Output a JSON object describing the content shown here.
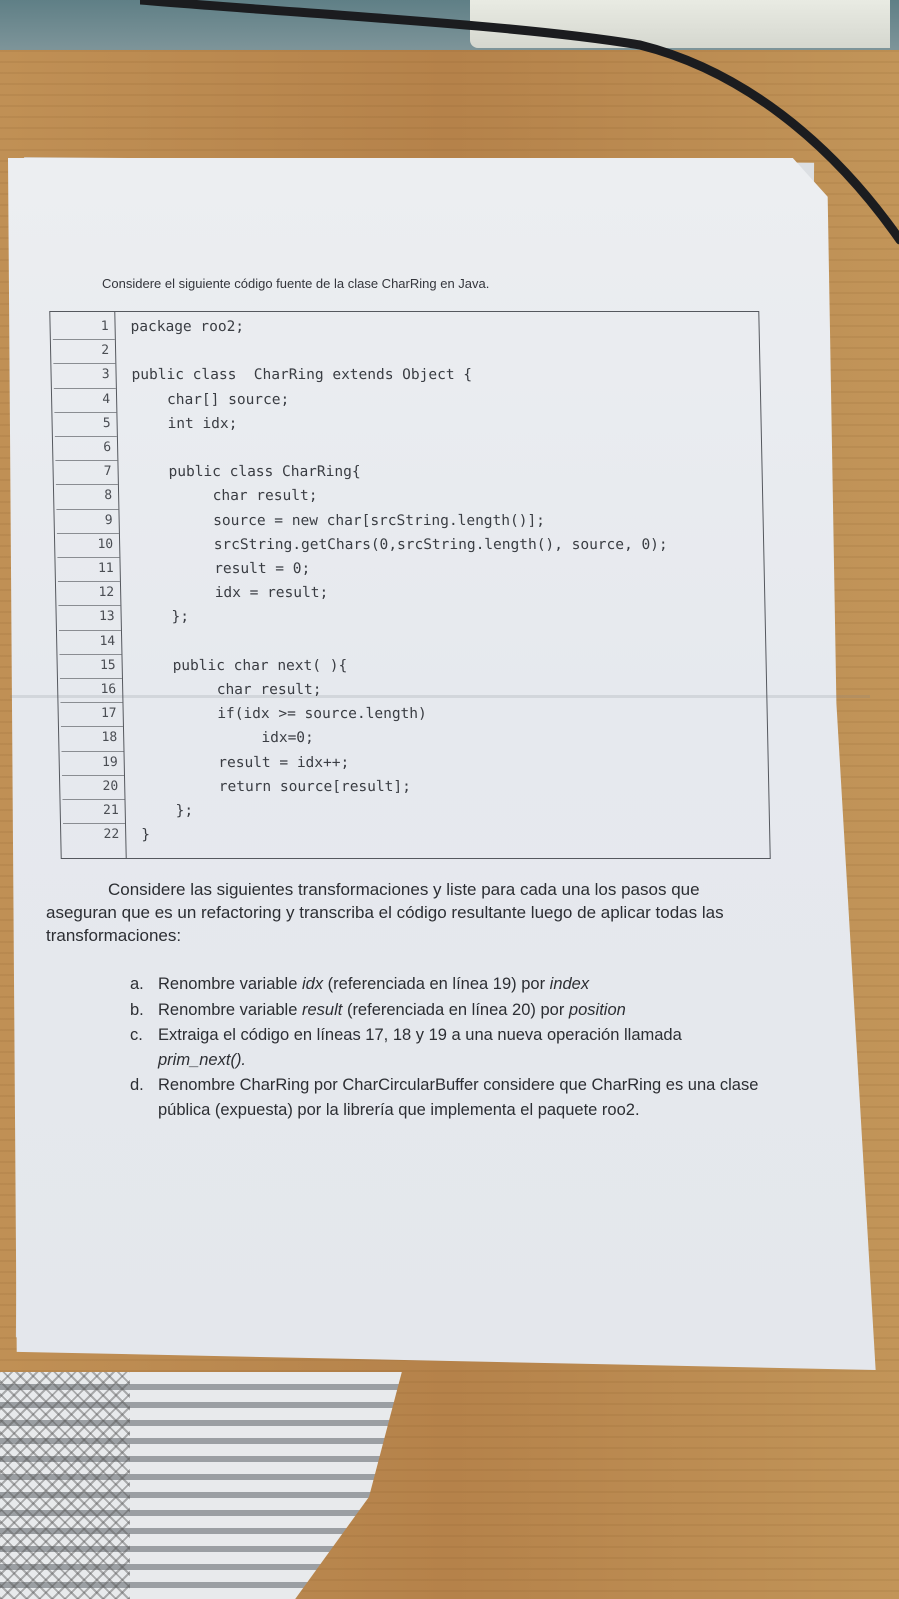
{
  "intro": "Considere el siguiente código fuente de la clase CharRing en Java.",
  "code_lines": [
    {
      "n": "1",
      "text": "package roo2;"
    },
    {
      "n": "2",
      "text": ""
    },
    {
      "n": "3",
      "text": "public class  CharRing extends Object {"
    },
    {
      "n": "4",
      "text": "    char[] source;"
    },
    {
      "n": "5",
      "text": "    int idx;"
    },
    {
      "n": "6",
      "text": ""
    },
    {
      "n": "7",
      "text": "    public class CharRing{"
    },
    {
      "n": "8",
      "text": "         char result;"
    },
    {
      "n": "9",
      "text": "         source = new char[srcString.length()];"
    },
    {
      "n": "10",
      "text": "         srcString.getChars(0,srcString.length(), source, 0);"
    },
    {
      "n": "11",
      "text": "         result = 0;"
    },
    {
      "n": "12",
      "text": "         idx = result;"
    },
    {
      "n": "13",
      "text": "    };"
    },
    {
      "n": "14",
      "text": ""
    },
    {
      "n": "15",
      "text": "    public char next( ){"
    },
    {
      "n": "16",
      "text": "         char result;"
    },
    {
      "n": "17",
      "text": "         if(idx >= source.length)"
    },
    {
      "n": "18",
      "text": "              idx=0;"
    },
    {
      "n": "19",
      "text": "         result = idx++;"
    },
    {
      "n": "20",
      "text": "         return source[result];"
    },
    {
      "n": "21",
      "text": "    };"
    },
    {
      "n": "22",
      "text": "}"
    }
  ],
  "prompt": {
    "part1": "Considere las siguientes transformaciones y liste para cada una los pasos que",
    "part2": "aseguran que es un refactoring y transcriba el código resultante luego de aplicar todas las transformaciones:"
  },
  "tasks": [
    {
      "marker": "a.",
      "pre": "Renombre variable ",
      "em1": "idx",
      "mid": " (referenciada en línea 19) por ",
      "em2": "index",
      "post": ""
    },
    {
      "marker": "b.",
      "pre": "Renombre variable ",
      "em1": "result",
      "mid": " (referenciada en línea 20) por ",
      "em2": "position",
      "post": ""
    },
    {
      "marker": "c.",
      "pre": "Extraiga el código en líneas 17, 18 y 19 a una nueva operación llamada ",
      "em1": "prim_next().",
      "mid": "",
      "em2": "",
      "post": ""
    },
    {
      "marker": "d.",
      "pre": "Renombre CharRing por CharCircularBuffer considere que CharRing es una clase pública (expuesta) por la librería que implementa el paquete roo2.",
      "em1": "",
      "mid": "",
      "em2": "",
      "post": ""
    }
  ]
}
